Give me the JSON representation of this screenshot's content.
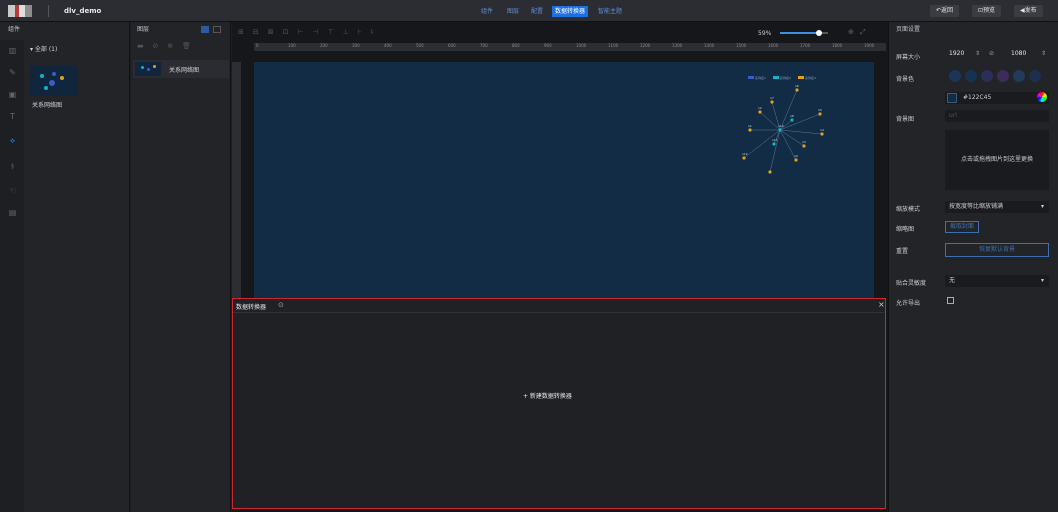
{
  "topbar": {
    "project_name": "dlv_demo",
    "nav": [
      "组件",
      "图层",
      "配置",
      "数据转换器",
      "智能主题"
    ],
    "active_nav": "数据转换器",
    "back": "返回",
    "preview": "预览",
    "publish": "发布"
  },
  "left": {
    "header": "组件",
    "group": "全部 (1)",
    "component_label": "关系网络图"
  },
  "layers": {
    "header": "图层",
    "item": "关系网络图"
  },
  "toolbar": {
    "zoom": "59%"
  },
  "ruler": {
    "ticks": [
      "0",
      "100",
      "200",
      "300",
      "400",
      "500",
      "600",
      "700",
      "800",
      "900",
      "1000",
      "1100",
      "1200",
      "1300",
      "1400",
      "1500",
      "1600",
      "1700",
      "1800",
      "1900"
    ]
  },
  "graph": {
    "legend": [
      "系列名1",
      "系列名2",
      "系列名3"
    ],
    "node_labels": [
      "n6",
      "n7",
      "n2",
      "n5",
      "n8",
      "n1",
      "n10",
      "n4",
      "n11",
      "n3",
      "n12",
      "n9"
    ],
    "colors": {
      "series1": "#3a5ec8",
      "series2": "#12b5c6",
      "series3": "#e0a21b"
    }
  },
  "data_transformer": {
    "title": "数据转换器",
    "new_button": "+ 新建数据转换器"
  },
  "right": {
    "header": "页面设置",
    "screen_size_label": "屏幕大小",
    "width": "1920",
    "height": "1080",
    "bg_color_label": "背景色",
    "bg_color_value": "#122C45",
    "bg_image_label": "背景图",
    "bg_url_placeholder": "url",
    "upload_hint": "点击或拖拽图片到这里更换",
    "zoom_mode_label": "缩放模式",
    "zoom_mode_value": "按宽度等比缩放铺满",
    "thumbnail_label": "缩略图",
    "capture_cover": "截取封面",
    "reset_label": "重置",
    "restore_default": "恢复默认背景",
    "snap_label": "贴合灵敏度",
    "snap_value": "无",
    "allow_export_label": "允许导出",
    "swatches": [
      "#1c3557",
      "#16324f",
      "#2a2f5a",
      "#3b2c5a",
      "#223a5c",
      "#1c2f4d"
    ]
  }
}
